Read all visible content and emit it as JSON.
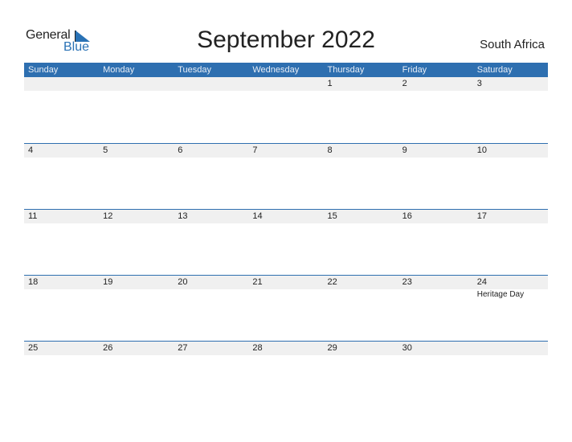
{
  "logo": {
    "line1": "General",
    "line2": "Blue"
  },
  "title": "September 2022",
  "country": "South Africa",
  "weekdays": [
    "Sunday",
    "Monday",
    "Tuesday",
    "Wednesday",
    "Thursday",
    "Friday",
    "Saturday"
  ],
  "weeks": [
    {
      "days": [
        "",
        "",
        "",
        "",
        "1",
        "2",
        "3"
      ],
      "holidays": [
        "",
        "",
        "",
        "",
        "",
        "",
        ""
      ]
    },
    {
      "days": [
        "4",
        "5",
        "6",
        "7",
        "8",
        "9",
        "10"
      ],
      "holidays": [
        "",
        "",
        "",
        "",
        "",
        "",
        ""
      ]
    },
    {
      "days": [
        "11",
        "12",
        "13",
        "14",
        "15",
        "16",
        "17"
      ],
      "holidays": [
        "",
        "",
        "",
        "",
        "",
        "",
        ""
      ]
    },
    {
      "days": [
        "18",
        "19",
        "20",
        "21",
        "22",
        "23",
        "24"
      ],
      "holidays": [
        "",
        "",
        "",
        "",
        "",
        "",
        "Heritage Day"
      ]
    },
    {
      "days": [
        "25",
        "26",
        "27",
        "28",
        "29",
        "30",
        ""
      ],
      "holidays": [
        "",
        "",
        "",
        "",
        "",
        "",
        ""
      ]
    }
  ],
  "colors": {
    "accent": "#2e6fb0",
    "strip": "#f0f0f0"
  }
}
